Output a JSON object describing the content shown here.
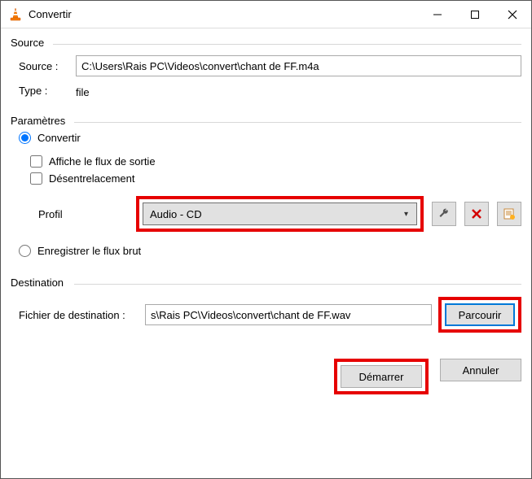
{
  "window": {
    "title": "Convertir"
  },
  "source": {
    "legend": "Source",
    "label": "Source :",
    "value": "C:\\Users\\Rais PC\\Videos\\convert\\chant de FF.m4a",
    "type_label": "Type :",
    "type_value": "file"
  },
  "params": {
    "legend": "Paramètres",
    "convert_label": "Convertir",
    "show_output_label": "Affiche le flux de sortie",
    "deinterlace_label": "Désentrelacement",
    "profile_label": "Profil",
    "profile_value": "Audio - CD",
    "raw_stream_label": "Enregistrer le flux brut"
  },
  "dest": {
    "legend": "Destination",
    "label": "Fichier de destination :",
    "value": "s\\Rais PC\\Videos\\convert\\chant de FF.wav",
    "browse_label": "Parcourir"
  },
  "actions": {
    "start_label": "Démarrer",
    "cancel_label": "Annuler"
  },
  "icons": {
    "wrench": "wrench-icon",
    "delete": "delete-icon",
    "new": "new-profile-icon"
  }
}
